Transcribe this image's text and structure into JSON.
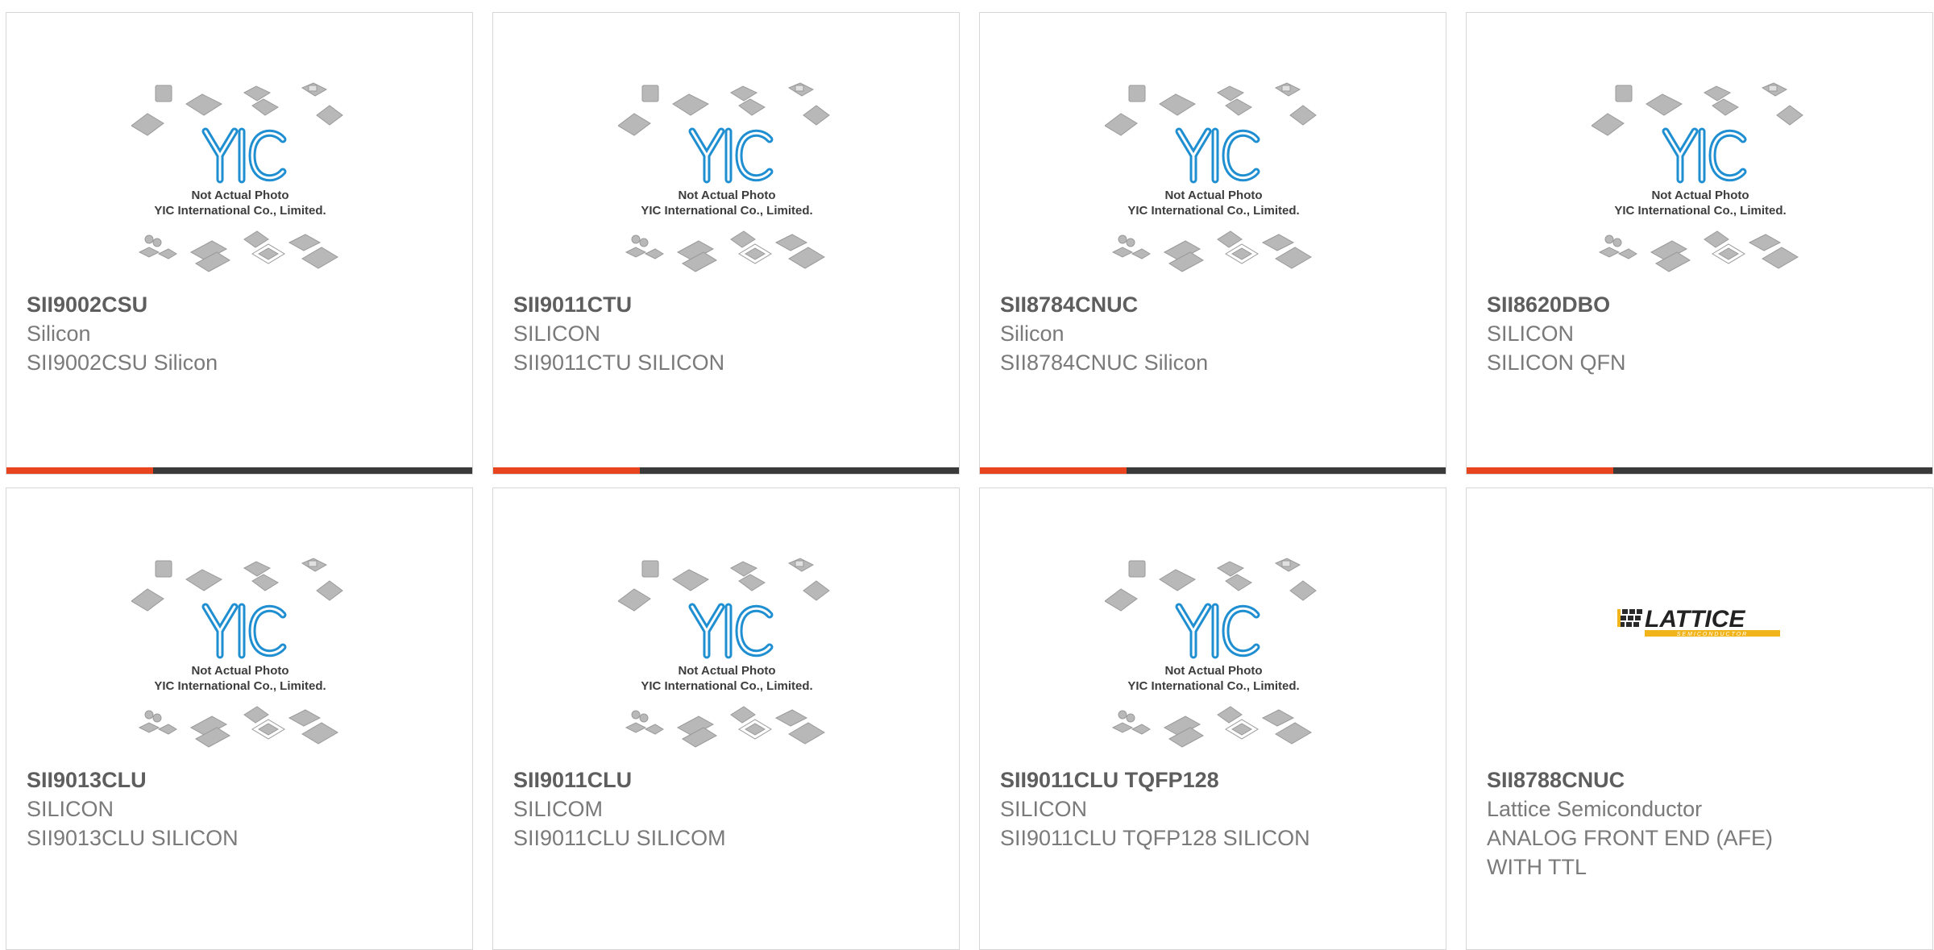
{
  "colors": {
    "accent": "#e8451e",
    "bar_dark": "#3a3a3a",
    "logo_blue": "#1f8fd1",
    "lattice_gold": "#f2b41b"
  },
  "placeholder": {
    "line1": "Not Actual Photo",
    "line2": "YIC International Co., Limited."
  },
  "lattice_logo": {
    "name": "LATTICE",
    "tagline": "SEMICONDUCTOR"
  },
  "products": [
    {
      "part": "SII9002CSU",
      "manufacturer": "Silicon",
      "description": "SII9002CSU Silicon",
      "image": "yic-placeholder"
    },
    {
      "part": "SII9011CTU",
      "manufacturer": "SILICON",
      "description": "SII9011CTU SILICON",
      "image": "yic-placeholder"
    },
    {
      "part": "SII8784CNUC",
      "manufacturer": "Silicon",
      "description": "SII8784CNUC Silicon",
      "image": "yic-placeholder"
    },
    {
      "part": "SII8620DBO",
      "manufacturer": "SILICON",
      "description": "SILICON QFN",
      "image": "yic-placeholder"
    },
    {
      "part": "SII9013CLU",
      "manufacturer": "SILICON",
      "description": "SII9013CLU SILICON",
      "image": "yic-placeholder"
    },
    {
      "part": "SII9011CLU",
      "manufacturer": "SILICOM",
      "description": "SII9011CLU SILICOM",
      "image": "yic-placeholder"
    },
    {
      "part": "SII9011CLU TQFP128",
      "manufacturer": "SILICON",
      "description": "SII9011CLU TQFP128 SILICON",
      "image": "yic-placeholder"
    },
    {
      "part": "SII8788CNUC",
      "manufacturer": "Lattice Semiconductor",
      "description": "ANALOG FRONT END (AFE) WITH TTL",
      "image": "lattice-logo"
    }
  ]
}
